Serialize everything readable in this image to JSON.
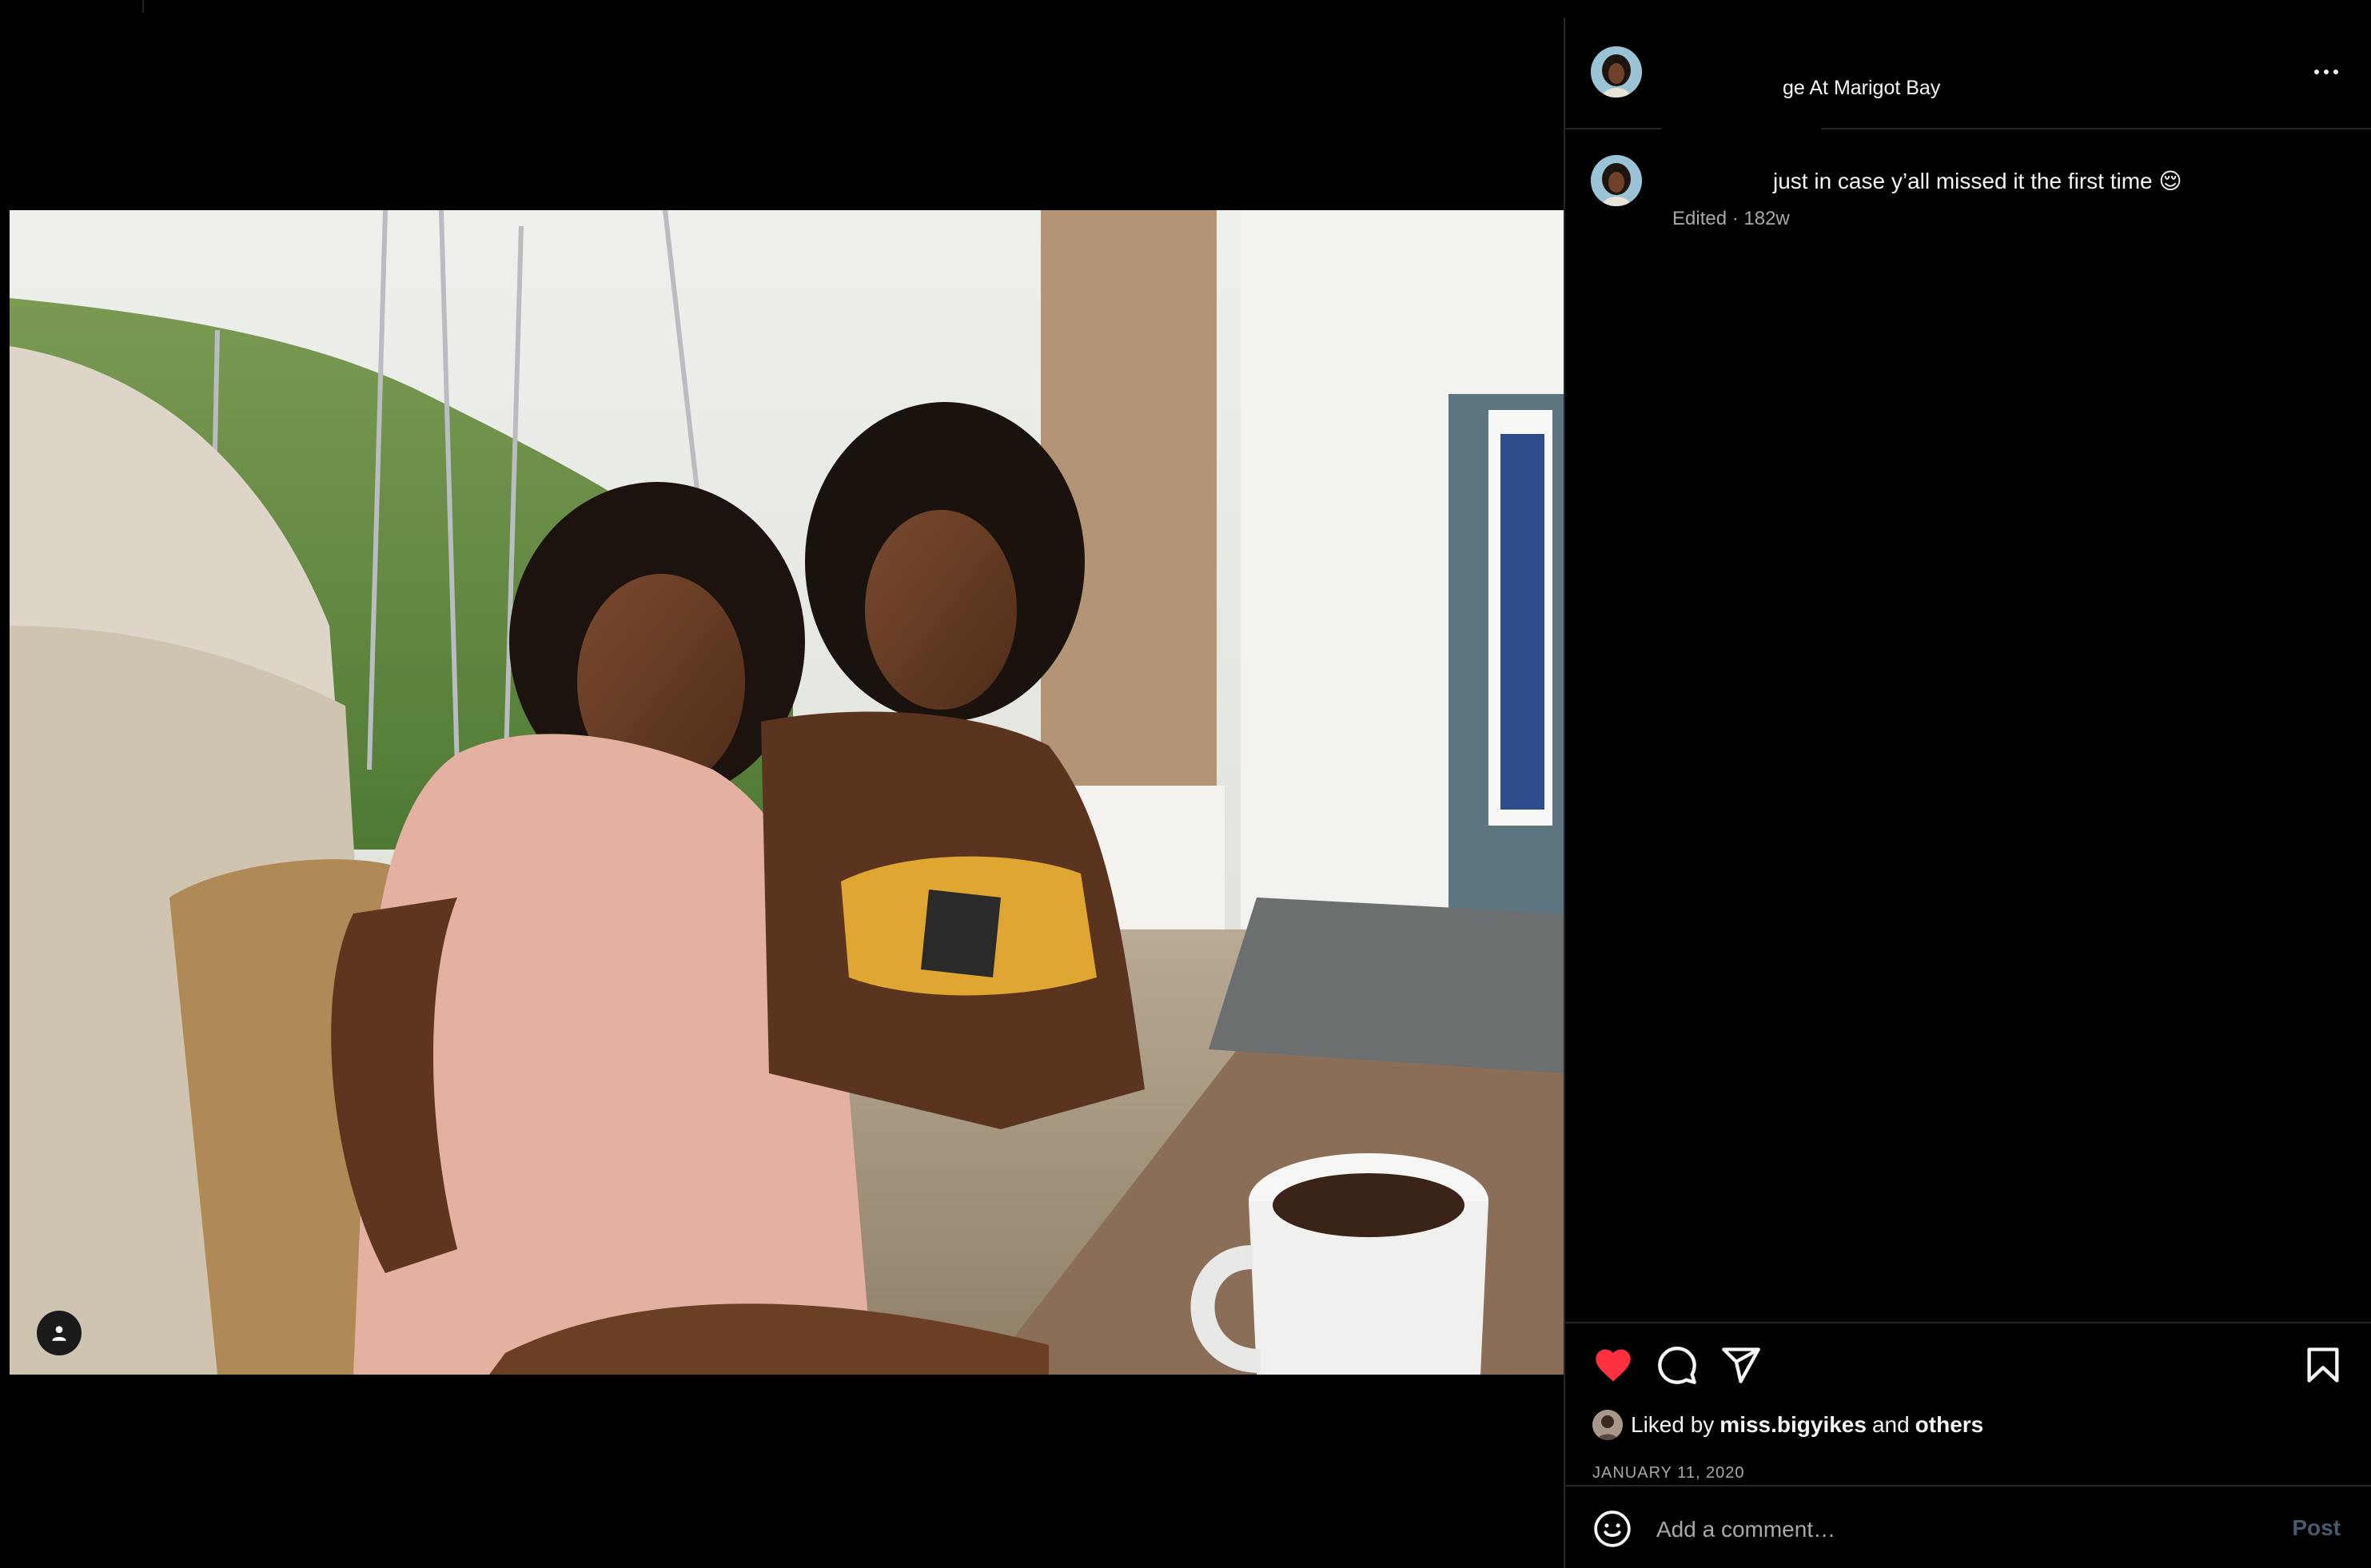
{
  "post": {
    "location": "ge At Marigot Bay",
    "caption": "just in case y’all missed it the first time 😌",
    "caption_meta": "Edited · 182w",
    "liked_by_prefix": "Liked by",
    "liked_by_user": "miss.bigyikes",
    "liked_by_and": "and",
    "liked_by_others": "others",
    "date": "JANUARY 11, 2020"
  },
  "comment_box": {
    "placeholder": "Add a comment…",
    "post_label": "Post"
  },
  "icons": {
    "more": "more-options-icon",
    "like": "heart-filled-icon",
    "comment": "comment-bubble-icon",
    "share": "paper-plane-icon",
    "save": "bookmark-icon",
    "emoji": "emoji-smile-icon",
    "tag_user": "user-tag-icon"
  },
  "colors": {
    "background": "#000000",
    "like_red": "#ff3040",
    "muted_text": "#a8a8a8",
    "post_button": "#4a5a6e"
  }
}
